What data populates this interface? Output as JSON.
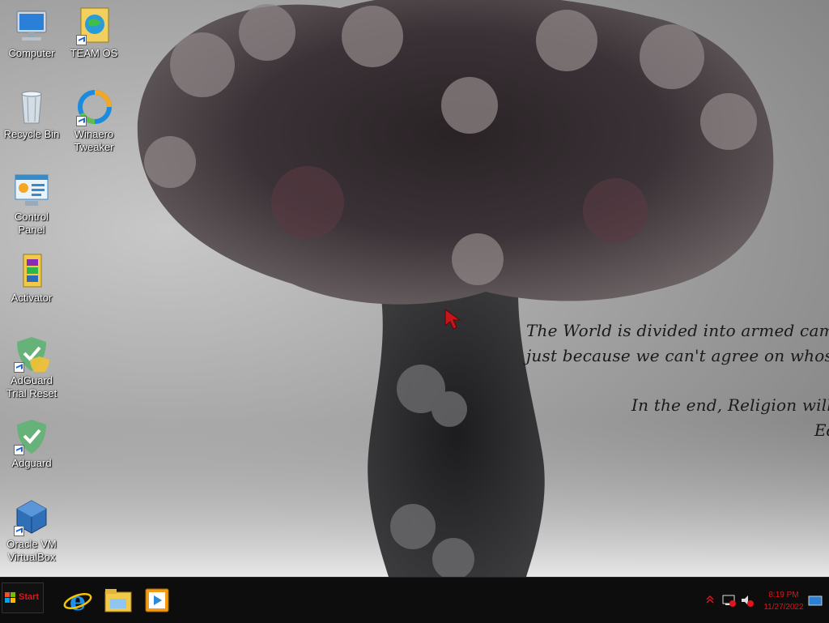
{
  "desktop": {
    "icons": [
      {
        "label": "Computer",
        "icon": "computer-icon",
        "shortcut": false
      },
      {
        "label": "TEAM OS",
        "icon": "team-os-icon",
        "shortcut": true
      },
      {
        "label": "Recycle Bin",
        "icon": "recycle-bin-icon",
        "shortcut": false
      },
      {
        "label": "Winaero Tweaker",
        "icon": "winaero-tweaker-icon",
        "shortcut": true
      },
      {
        "label": "Control Panel",
        "icon": "control-panel-icon",
        "shortcut": false
      },
      {
        "label": "Activator",
        "icon": "winrar-archive-icon",
        "shortcut": false
      },
      {
        "label": "AdGuard Trial Reset",
        "icon": "adguard-shield-icon",
        "shortcut": true
      },
      {
        "label": "Adguard",
        "icon": "adguard-shield-icon",
        "shortcut": true
      },
      {
        "label": "Oracle VM VirtualBox",
        "icon": "virtualbox-icon",
        "shortcut": true
      }
    ]
  },
  "wallpaper": {
    "quote_line1": "The World is divided into armed camps ready to comm",
    "quote_line2": "just because we can't agree on whose fairy tales to b",
    "quote_line3": "In the end, Religion will kill us all.",
    "quote_line4": "Ed"
  },
  "taskbar": {
    "start_label": "Start",
    "pinned": [
      "internet-explorer-icon",
      "file-explorer-icon",
      "media-player-icon"
    ],
    "tray": {
      "time": "8:19 PM",
      "date": "11/27/2022",
      "icons": [
        "show-hidden-icons-chevron",
        "network-icon",
        "volume-muted-icon",
        "show-desktop-icon"
      ]
    }
  },
  "colors": {
    "taskbar_bg": "#0d0d0d",
    "accent_red": "#e0141a"
  }
}
